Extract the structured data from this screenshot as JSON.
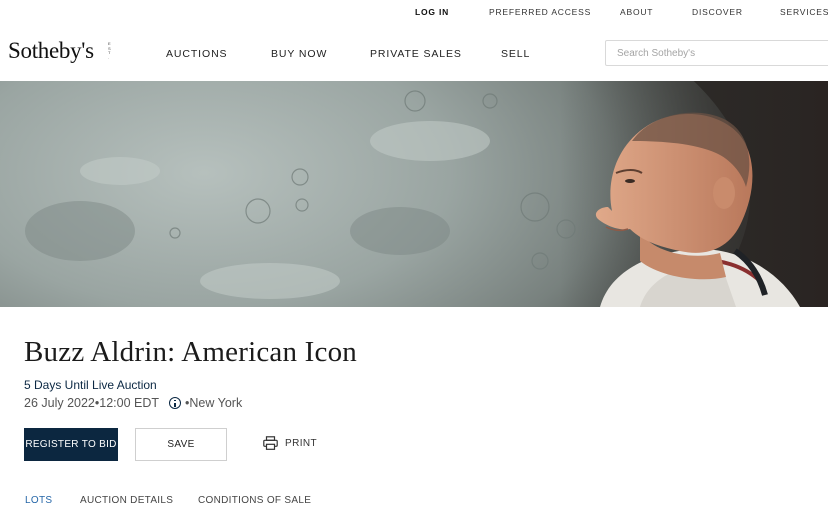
{
  "utility_nav": {
    "login": "LOG IN",
    "preferred_access": "PREFERRED ACCESS",
    "about": "ABOUT",
    "discover": "DISCOVER",
    "services": "SERVICES"
  },
  "header": {
    "logo": "Sotheby's",
    "logo_est": [
      "E",
      "S",
      "T",
      ".",
      "1",
      "7",
      "4",
      "4"
    ],
    "nav": {
      "auctions": "AUCTIONS",
      "buy_now": "BUY NOW",
      "private_sales": "PRIVATE SALES",
      "sell": "SELL"
    },
    "search_placeholder": "Search Sotheby's"
  },
  "auction": {
    "title": "Buzz Aldrin: American Icon",
    "countdown": "5 Days Until Live Auction",
    "date": "26 July 2022•12:00 EDT",
    "location": "•New York"
  },
  "actions": {
    "register": "REGISTER TO BID",
    "save": "SAVE",
    "print": "PRINT"
  },
  "tabs": {
    "lots": "LOTS",
    "auction_details": "AUCTION DETAILS",
    "conditions": "CONDITIONS OF SALE"
  },
  "colors": {
    "navy": "#0c2740",
    "tab_active": "#2566a8"
  },
  "icons": {
    "info": "info-icon",
    "print": "printer-icon"
  }
}
